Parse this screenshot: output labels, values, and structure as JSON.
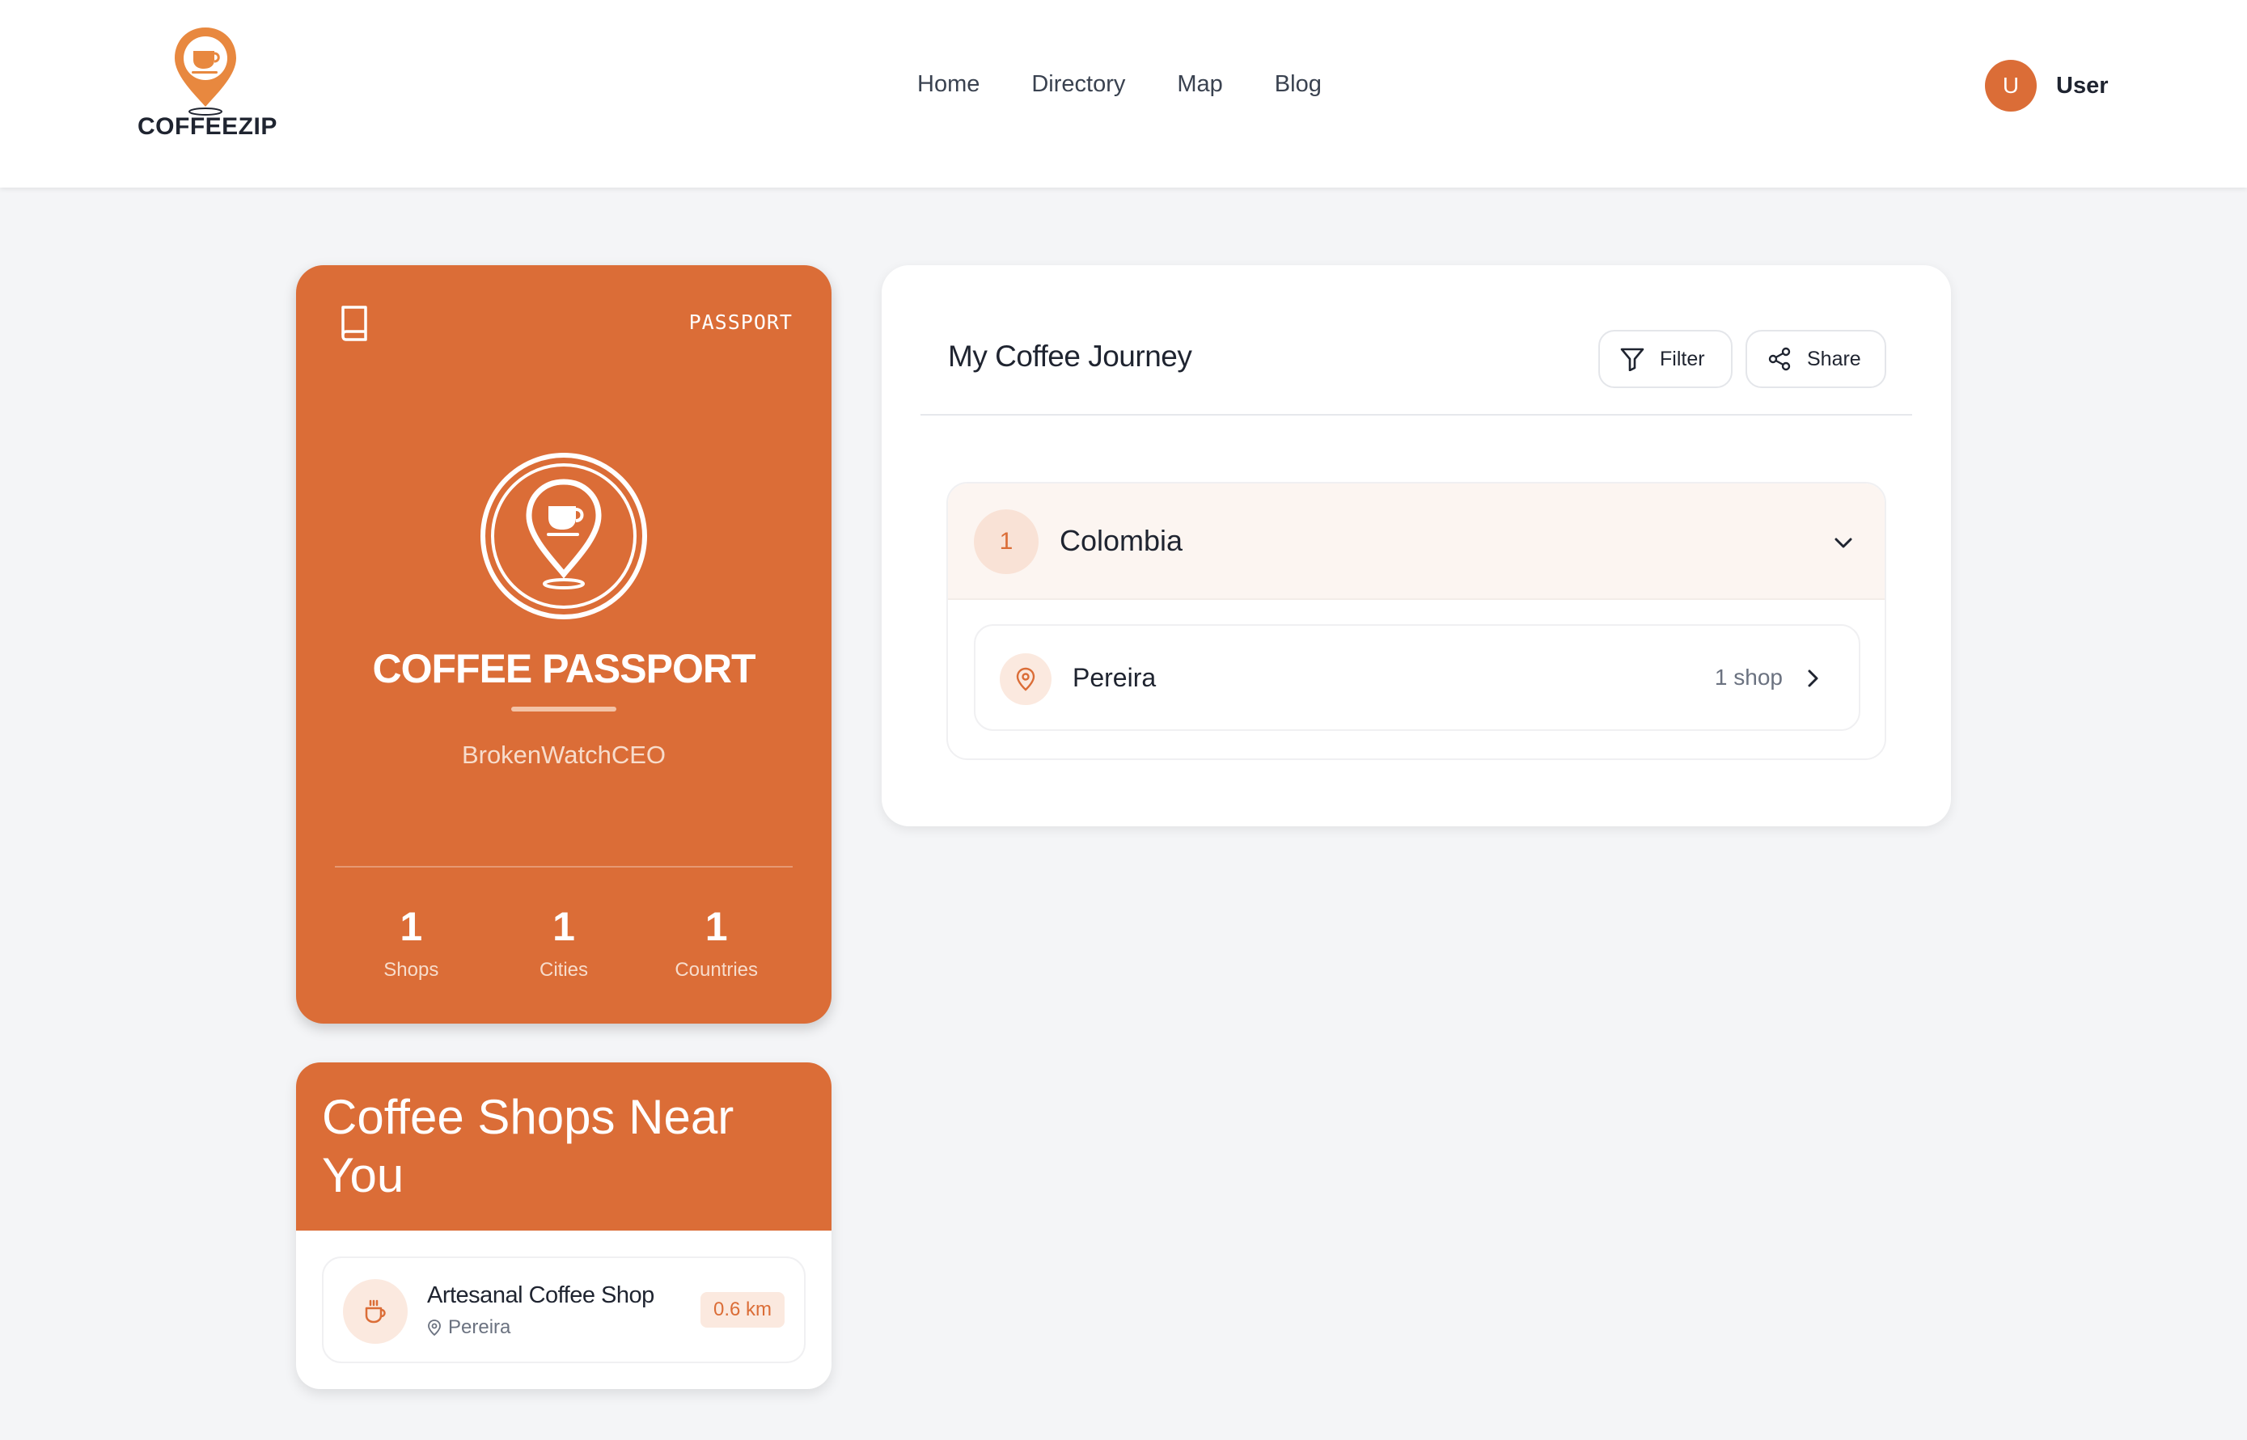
{
  "brand": {
    "name": "COFFEEZIP",
    "accent": "#db6d37"
  },
  "nav": {
    "items": [
      "Home",
      "Directory",
      "Map",
      "Blog"
    ]
  },
  "user": {
    "initial": "U",
    "name": "User"
  },
  "passport": {
    "label": "PASSPORT",
    "title": "COFFEE PASSPORT",
    "username": "BrokenWatchCEO",
    "stats": [
      {
        "value": "1",
        "label": "Shops"
      },
      {
        "value": "1",
        "label": "Cities"
      },
      {
        "value": "1",
        "label": "Countries"
      }
    ]
  },
  "near": {
    "title": "Coffee Shops Near You",
    "items": [
      {
        "name": "Artesanal Coffee Shop",
        "city": "Pereira",
        "distance": "0.6 km"
      }
    ]
  },
  "journey": {
    "title": "My Coffee Journey",
    "filter_label": "Filter",
    "share_label": "Share",
    "countries": [
      {
        "count": "1",
        "name": "Colombia",
        "cities": [
          {
            "name": "Pereira",
            "count": "1 shop"
          }
        ]
      }
    ]
  }
}
